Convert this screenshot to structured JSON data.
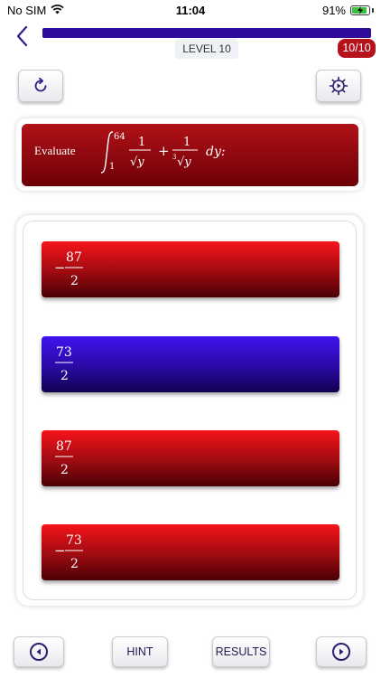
{
  "status_bar": {
    "carrier": "No SIM",
    "time": "11:04",
    "battery_percent": "91%",
    "battery_level": 0.91,
    "wifi_icon": "wifi-icon",
    "charging_icon": "bolt-icon"
  },
  "header": {
    "back_icon": "chevron-left-icon",
    "progress": 1.0,
    "level_label": "LEVEL 10",
    "question_count": "10/10"
  },
  "toolbar": {
    "refresh_icon": "refresh-icon",
    "settings_icon": "gear-icon"
  },
  "question": {
    "prefix": "Evaluate",
    "integral_lower": "1",
    "integral_upper": "64",
    "term1_num": "1",
    "term1_den": "√y",
    "plus": "+",
    "term2_num": "1",
    "term2_den_root_index": "3",
    "term2_den": "√y",
    "differential": "dy:"
  },
  "answers": [
    {
      "sign": "−",
      "numerator": "87",
      "denominator": "2",
      "state": "default"
    },
    {
      "sign": "",
      "numerator": "73",
      "denominator": "2",
      "state": "selected"
    },
    {
      "sign": "",
      "numerator": "87",
      "denominator": "2",
      "state": "default"
    },
    {
      "sign": "−",
      "numerator": "73",
      "denominator": "2",
      "state": "default"
    }
  ],
  "bottom_bar": {
    "prev_icon": "previous-icon",
    "hint_label": "HINT",
    "results_label": "RESULTS",
    "next_icon": "next-icon"
  },
  "colors": {
    "accent_dark_blue": "#2f0c9a",
    "answer_red": "#d61218",
    "answer_selected_blue": "#3f12ee",
    "badge_red": "#b5121b"
  }
}
